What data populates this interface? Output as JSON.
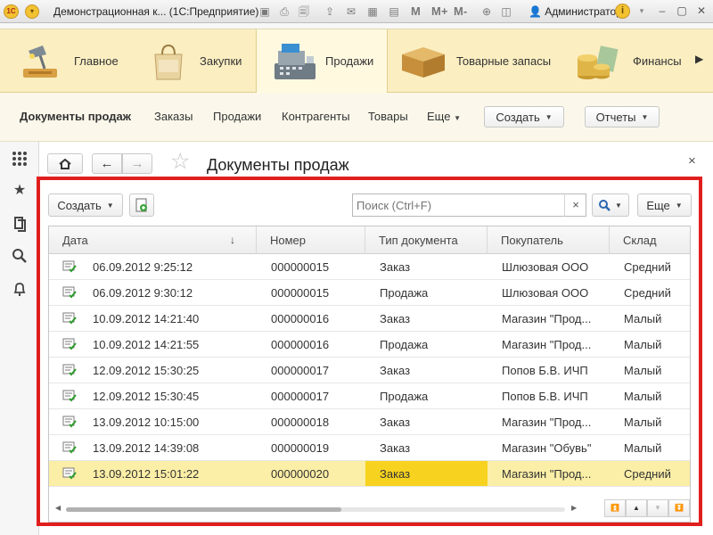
{
  "titlebar": {
    "logo": "1C",
    "menu_glyph": "▾",
    "title": "Демонстрационная к...  (1С:Предприятие)",
    "m_labels": [
      "M",
      "M+",
      "M-"
    ],
    "user": "Администратор",
    "info_glyph": "i",
    "window_buttons": [
      "–",
      "▢",
      "✕"
    ]
  },
  "sections": {
    "items": [
      {
        "label": "Главное",
        "icon": "desk-lamp-icon"
      },
      {
        "label": "Закупки",
        "icon": "shopping-bag-icon"
      },
      {
        "label": "Продажи",
        "icon": "cash-register-icon",
        "active": true
      },
      {
        "label": "Товарные запасы",
        "icon": "box-icon"
      },
      {
        "label": "Финансы",
        "icon": "coins-icon"
      }
    ],
    "more": "▶"
  },
  "subnav": {
    "current": "Документы продаж",
    "links": [
      "Заказы",
      "Продажи",
      "Контрагенты",
      "Товары",
      "Еще"
    ],
    "create_button": "Создать",
    "reports_button": "Отчеты"
  },
  "form": {
    "title": "Документы продаж",
    "close": "×",
    "create_button": "Создать",
    "search_placeholder": "Поиск (Ctrl+F)",
    "search_clear": "×",
    "more_button": "Еще",
    "sort_arrow": "↓",
    "columns": [
      "Дата",
      "Номер",
      "Тип документа",
      "Покупатель",
      "Склад"
    ],
    "rows": [
      {
        "date": "06.09.2012 9:25:12",
        "number": "000000015",
        "type": "Заказ",
        "customer": "Шлюзовая ООО",
        "warehouse": "Средний"
      },
      {
        "date": "06.09.2012 9:30:12",
        "number": "000000015",
        "type": "Продажа",
        "customer": "Шлюзовая ООО",
        "warehouse": "Средний"
      },
      {
        "date": "10.09.2012 14:21:40",
        "number": "000000016",
        "type": "Заказ",
        "customer": "Магазин \"Прод...",
        "warehouse": "Малый"
      },
      {
        "date": "10.09.2012 14:21:55",
        "number": "000000016",
        "type": "Продажа",
        "customer": "Магазин \"Прод...",
        "warehouse": "Малый"
      },
      {
        "date": "12.09.2012 15:30:25",
        "number": "000000017",
        "type": "Заказ",
        "customer": "Попов Б.В. ИЧП",
        "warehouse": "Малый"
      },
      {
        "date": "12.09.2012 15:30:45",
        "number": "000000017",
        "type": "Продажа",
        "customer": "Попов Б.В. ИЧП",
        "warehouse": "Малый"
      },
      {
        "date": "13.09.2012 10:15:00",
        "number": "000000018",
        "type": "Заказ",
        "customer": "Магазин \"Прод...",
        "warehouse": "Малый"
      },
      {
        "date": "13.09.2012 14:39:08",
        "number": "000000019",
        "type": "Заказ",
        "customer": "Магазин \"Обувь\"",
        "warehouse": "Малый"
      },
      {
        "date": "13.09.2012 15:01:22",
        "number": "000000020",
        "type": "Заказ",
        "customer": "Магазин \"Прод...",
        "warehouse": "Средний",
        "selected": true
      }
    ]
  },
  "colors": {
    "sections_bg": "#fbeec1",
    "selection_row": "#fbeea6",
    "current_cell": "#f7d21f",
    "highlight_frame": "#e01e1e"
  }
}
